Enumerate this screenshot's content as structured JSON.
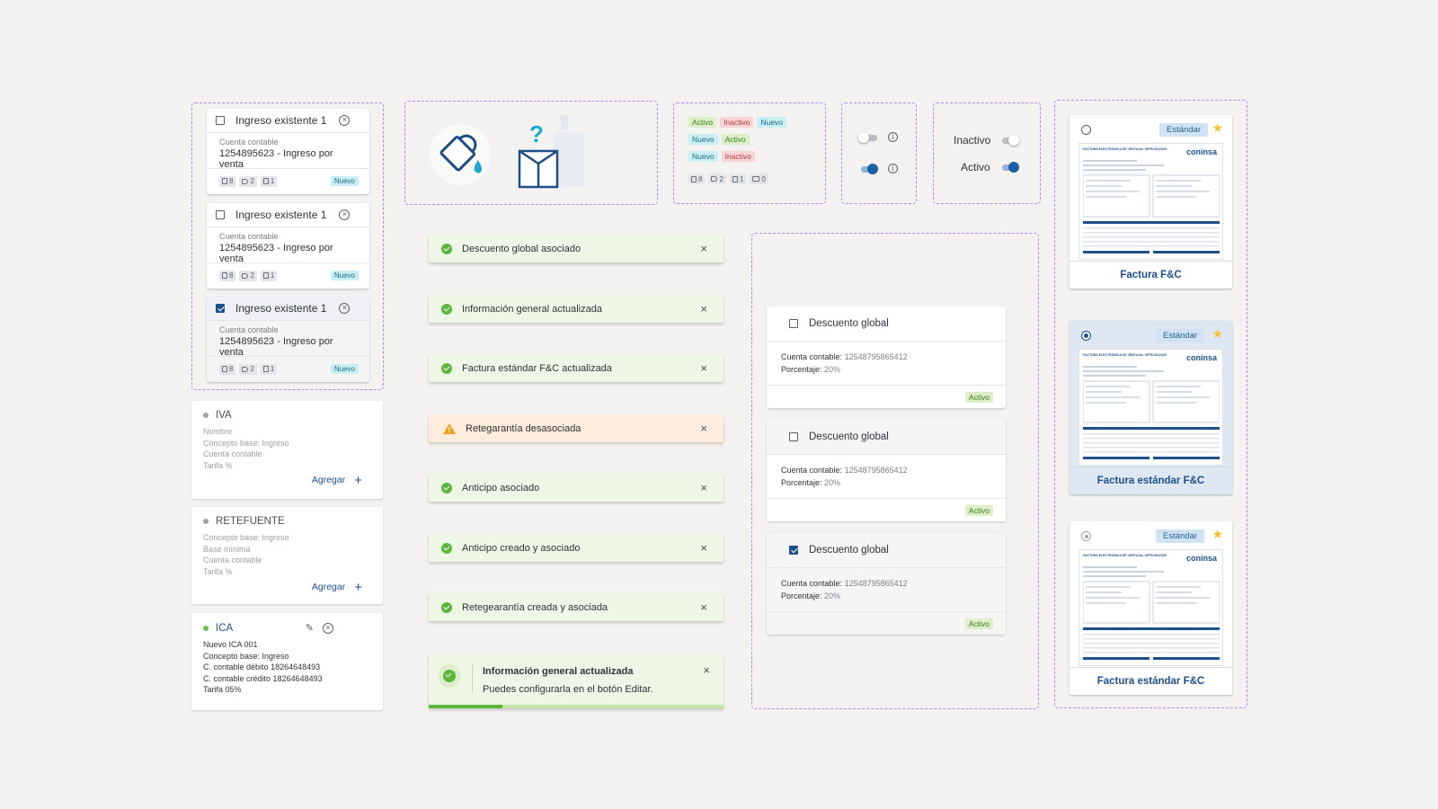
{
  "ingresos": [
    {
      "title": "Ingreso existente 1",
      "sub": "Cuenta contable",
      "account": "1254895623 - Ingreso por venta",
      "c1": "8",
      "c2": "2",
      "c3": "1",
      "badge": "Nuevo",
      "checked": false
    },
    {
      "title": "Ingreso existente 1",
      "sub": "Cuenta contable",
      "account": "1254895623 - Ingreso por venta",
      "c1": "8",
      "c2": "2",
      "c3": "1",
      "badge": "Nuevo",
      "checked": false
    },
    {
      "title": "Ingreso existente 1",
      "sub": "Cuenta contable",
      "account": "1254895623 - Ingreso por venta",
      "c1": "8",
      "c2": "2",
      "c3": "1",
      "badge": "Nuevo",
      "checked": true
    }
  ],
  "iva": {
    "title": "IVA",
    "lines": [
      "Nombre",
      "Concepto base: Ingreso",
      "Cuenta contable",
      "Tarifa %"
    ],
    "action": "Agregar"
  },
  "retefuente": {
    "title": "RETEFUENTE",
    "lines": [
      "Concepto base: Ingreso",
      "Base mínima",
      "Cuenta contable",
      "Tarifa %"
    ],
    "action": "Agregar"
  },
  "ica": {
    "title": "ICA",
    "name": "Nuevo ICA 001",
    "concepto_label": "Concepto base: ",
    "concepto_value": "Ingreso",
    "debito_label": "C. contable débito ",
    "debito_value": "18264648493",
    "credito_label": "C. contable crédito ",
    "credito_value": "18264648493",
    "tarifa_label": "Tarifa ",
    "tarifa_value": "05%"
  },
  "status_chips": {
    "row1": [
      "Activo",
      "Inactivo",
      "Nuevo"
    ],
    "row2": [
      "Nuevo",
      "Activo"
    ],
    "row3": [
      "Nuevo",
      "Inactivo"
    ],
    "counts": [
      "8",
      "2",
      "1",
      "0"
    ]
  },
  "toggles_labeled": {
    "inactive": "Inactivo",
    "active": "Activo"
  },
  "toasts": [
    {
      "text": "Descuento global asociado",
      "type": "success"
    },
    {
      "text": "Información general actualizada",
      "type": "success"
    },
    {
      "text": "Factura estándar F&C actualizada",
      "type": "success"
    },
    {
      "text": "Retegarantía desasociada",
      "type": "warning"
    },
    {
      "text": "Anticipo asociado",
      "type": "success"
    },
    {
      "text": "Anticipo creado y asociado",
      "type": "success"
    },
    {
      "text": "Retegearantía creada y asociada",
      "type": "success"
    }
  ],
  "big_toast": {
    "title": "Información general actualizada",
    "message": "Puedes configurarla en el botón Editar.",
    "progress": 0.25
  },
  "descuentos": [
    {
      "title": "Descuento global",
      "cuenta_label": "Cuenta contable: ",
      "cuenta_value": "12548795865412",
      "pct_label": "Porcentaje: ",
      "pct_value": "20%",
      "status": "Activo",
      "checked": false
    },
    {
      "title": "Descuento global",
      "cuenta_label": "Cuenta contable: ",
      "cuenta_value": "12548795865412",
      "pct_label": "Porcentaje: ",
      "pct_value": "20%",
      "status": "Activo",
      "checked": false
    },
    {
      "title": "Descuento global",
      "cuenta_label": "Cuenta contable: ",
      "cuenta_value": "12548795865412",
      "pct_label": "Porcentaje: ",
      "pct_value": "20%",
      "status": "Activo",
      "checked": true
    }
  ],
  "invoices": [
    {
      "badge": "Estándar",
      "label": "Factura F&C",
      "brand": "coninsa",
      "doc_title": "FACTURA ELECTRÓNICA DE VENTA No. OFFE-0012345"
    },
    {
      "badge": "Estándar",
      "label": "Factura estándar F&C",
      "brand": "coninsa",
      "doc_title": "FACTURA ELECTRÓNICA DE VENTA No. OFFE-0012345"
    },
    {
      "badge": "Estándar",
      "label": "Factura estándar F&C",
      "brand": "coninsa",
      "doc_title": "FACTURA ELECTRÓNICA DE VENTA No. OFFE-0012345"
    }
  ],
  "colors": {
    "primary": "#1d4f8a",
    "success": "#5bb73a",
    "warning": "#f0a021",
    "dashed_frame": "#b388f0"
  }
}
